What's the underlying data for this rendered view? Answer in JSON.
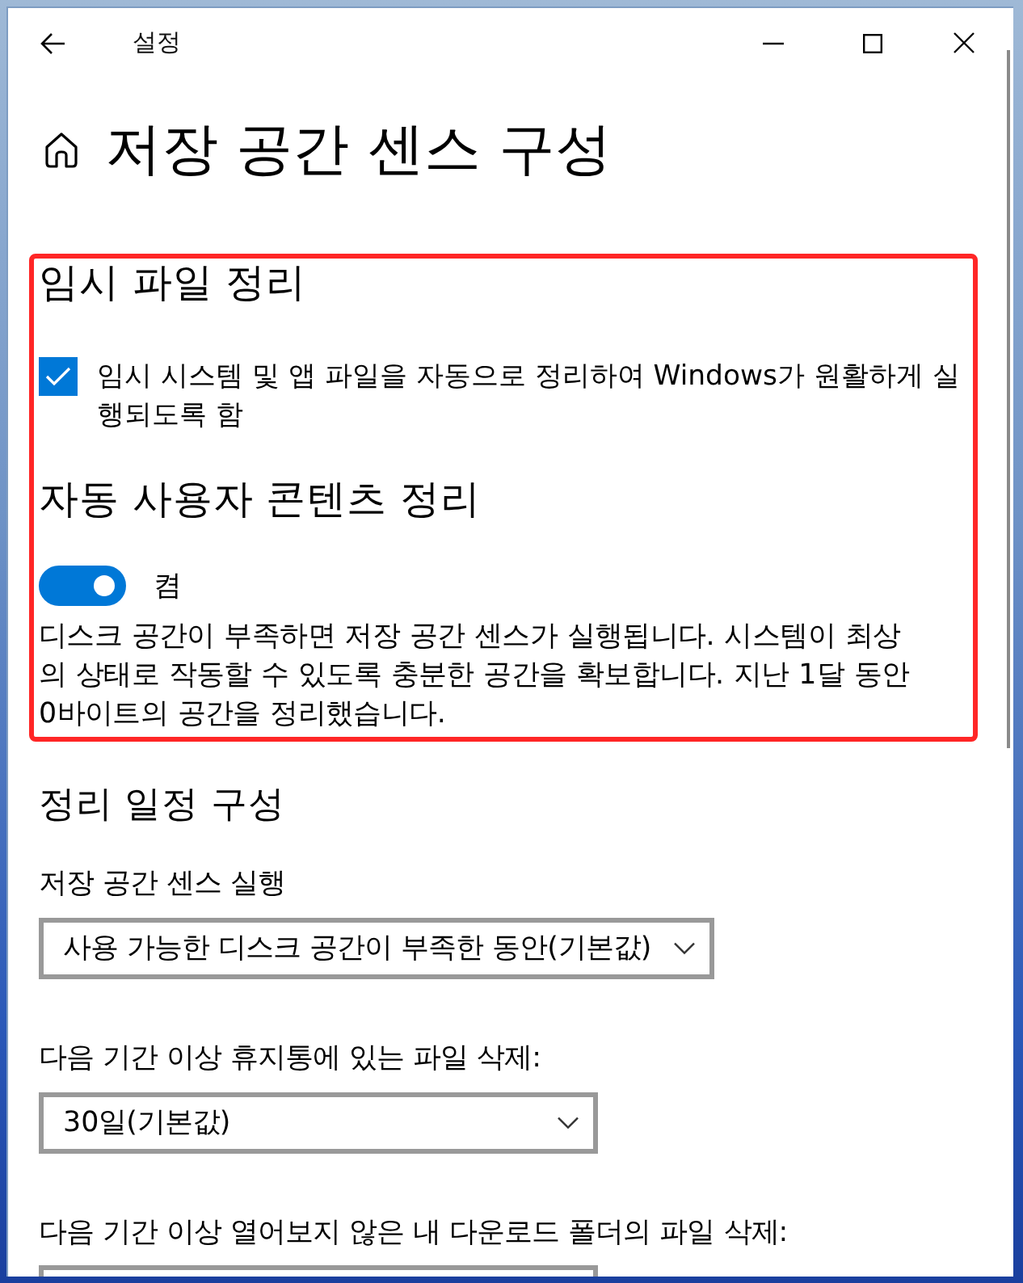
{
  "window": {
    "title": "설정"
  },
  "page": {
    "title": "저장 공간 센스 구성"
  },
  "storage_sense": {
    "highlighted": true,
    "sections": [
      {
        "kind": "checkbox",
        "heading": "임시 파일 정리",
        "label": "임시 시스템 및 앱 파일을 자동으로 정리하여 Windows가 원활하게 실행되도록 함",
        "checked": true
      },
      {
        "kind": "toggle",
        "heading": "자동 사용자 콘텐츠 정리",
        "state_label": "켬",
        "on": true,
        "description": "디스크 공간이 부족하면 저장 공간 센스가 실행됩니다. 시스템이 최상의 상태로 작동할 수 있도록 충분한 공간을 확보합니다. 지난 1달 동안 0바이트의 공간을 정리했습니다."
      }
    ]
  },
  "schedule": {
    "heading": "정리 일정 구성",
    "fields": [
      {
        "label": "저장 공간 센스 실행",
        "value": "사용 가능한 디스크 공간이 부족한 동안(기본값)"
      },
      {
        "label": "다음 기간 이상 휴지통에 있는 파일 삭제:",
        "value": "30일(기본값)"
      },
      {
        "label": "다음 기간 이상 열어보지 않은 내 다운로드 폴더의 파일 삭제:"
      }
    ]
  }
}
